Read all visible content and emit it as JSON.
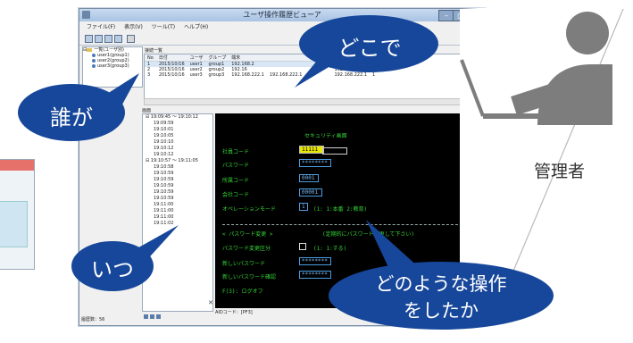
{
  "window": {
    "title": "ユーザ操作履歴ビューア",
    "buttons": {
      "minimize": "–",
      "maximize": "□",
      "close": "x"
    }
  },
  "menu": [
    "ファイル(F)",
    "表示(V)",
    "ツール(T)",
    "ヘルプ(H)"
  ],
  "user_tree": {
    "root": "一覧(ユーザ別)",
    "items": [
      "user1(group1)",
      "user2(group2)",
      "user3(group3)"
    ]
  },
  "table": {
    "tab_label": "接続一覧",
    "columns": [
      "No",
      "日付",
      "ユーザ",
      "グループ",
      "端末",
      "",
      "",
      "",
      "",
      "",
      "",
      "",
      "LU番号",
      "LU"
    ],
    "rows": [
      [
        "1",
        "2015/10/16",
        "user1",
        "group1",
        "192.168.2",
        "",
        "",
        "",
        "",
        "",
        "",
        "192.168.222.1",
        "1",
        ""
      ],
      [
        "2",
        "2015/10/16",
        "user2",
        "group2",
        "192.16",
        "",
        "",
        "",
        "",
        "",
        "",
        "192.168.222.1",
        "1",
        ""
      ],
      [
        "3",
        "2015/10/16",
        "user3",
        "group3",
        "192.168.222.1",
        "192.168.222.1",
        "",
        "",
        "",
        "",
        "",
        "192.168.222.1",
        "1",
        ""
      ]
    ]
  },
  "detail": {
    "tab_label": "画面",
    "tree": [
      {
        "label": "19:09:45 ～ 19:10:12",
        "level": 0
      },
      {
        "label": "19:09:59",
        "level": 1
      },
      {
        "label": "19:10:01",
        "level": 1
      },
      {
        "label": "19:10:05",
        "level": 1
      },
      {
        "label": "19:10:10",
        "level": 1
      },
      {
        "label": "19:10:12",
        "level": 1
      },
      {
        "label": "19:10:12",
        "level": 1
      },
      {
        "label": "19:10:57 ～ 19:11:05",
        "level": 0
      },
      {
        "label": "19:10:58",
        "level": 1
      },
      {
        "label": "19:10:59",
        "level": 1
      },
      {
        "label": "19:10:59",
        "level": 1
      },
      {
        "label": "19:10:59",
        "level": 1
      },
      {
        "label": "19:10:59",
        "level": 1
      },
      {
        "label": "19:10:59",
        "level": 1
      },
      {
        "label": "19:11:00",
        "level": 1
      },
      {
        "label": "19:11:00",
        "level": 1
      },
      {
        "label": "19:11:00",
        "level": 1
      },
      {
        "label": "19:11:02",
        "level": 1
      }
    ],
    "status": "AIDコード：[PF3]",
    "count": "履歴数：56"
  },
  "terminal": {
    "title": "セキュリティ画面",
    "labels": [
      "社員コード",
      "パスワード",
      "所属コード",
      "会社コード",
      "オペレーションモード"
    ],
    "values": [
      "11111",
      "********",
      "0001",
      "00001",
      "1"
    ],
    "mode_hint": "(1: 1:本番  2:教育)",
    "section": "< パスワード変更 >",
    "section_hint": "(定期的にパスワード変更して下さい)",
    "change_label": "パスワード変更区分",
    "change_hint": "(1: 1:する)",
    "new_pw_label": "新しいパスワード",
    "new_pw_value": "********",
    "confirm_label": "新しいパスワード確認",
    "confirm_value": "********",
    "pf": "F(3): ログオフ"
  },
  "callouts": {
    "who": "誰が",
    "where": "どこで",
    "when": "いつ",
    "what_line1": "どのような操作",
    "what_line2": "をしたか"
  },
  "admin_label": "管理者",
  "colors": {
    "bubble": "#17479a",
    "terminal_text": "#35d435",
    "terminal_field": "#4a9de0"
  }
}
